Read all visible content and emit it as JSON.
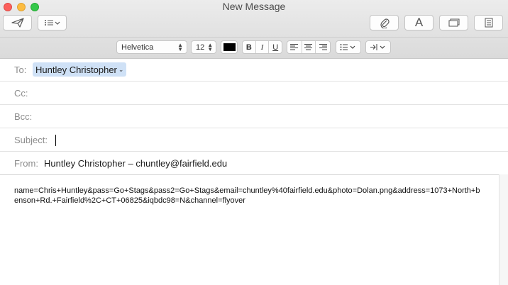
{
  "window": {
    "title": "New Message"
  },
  "format_bar": {
    "font_name": "Helvetica",
    "font_size": "12",
    "text_color": "#000000",
    "bold_label": "B",
    "italic_label": "I",
    "underline_label": "U"
  },
  "fields": {
    "to": {
      "label": "To:",
      "recipient": "Huntley Christopher"
    },
    "cc": {
      "label": "Cc:",
      "value": ""
    },
    "bcc": {
      "label": "Bcc:",
      "value": ""
    },
    "subject": {
      "label": "Subject:",
      "value": ""
    },
    "from": {
      "label": "From:",
      "value": "Huntley Christopher – chuntley@fairfield.edu"
    }
  },
  "body": {
    "text": "name=Chris+Huntley&pass=Go+Stags&pass2=Go+Stags&email=chuntley%40fairfield.edu&photo=Dolan.png&address=1073+North+benson+Rd.+Fairfield%2C+CT+06825&iqbdc98=N&channel=flyover"
  }
}
